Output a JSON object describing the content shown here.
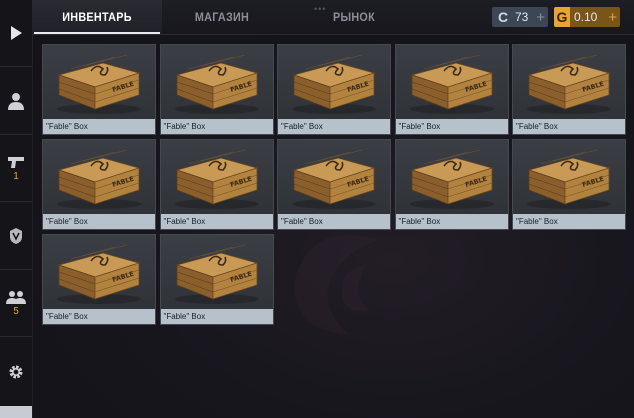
{
  "tabs": [
    {
      "label": "ИНВЕНТАРЬ",
      "active": true
    },
    {
      "label": "МАГАЗИН",
      "active": false
    },
    {
      "label": "РЫНОК",
      "active": false
    }
  ],
  "currency": {
    "silver": {
      "icon": "C",
      "value": "73",
      "plus": "+"
    },
    "gold": {
      "icon": "G",
      "value": "0.10",
      "plus": "+"
    }
  },
  "sidebar": {
    "items": [
      {
        "icon": "play-icon",
        "count": ""
      },
      {
        "icon": "profile-icon",
        "count": ""
      },
      {
        "icon": "pistol-icon",
        "count": "1"
      },
      {
        "icon": "emblem-icon",
        "count": ""
      },
      {
        "icon": "friends-icon",
        "count": "5"
      },
      {
        "icon": "gear-icon",
        "count": ""
      }
    ]
  },
  "inventory": {
    "items": [
      {
        "name": "\"Fable\" Box",
        "stamp": "FABLE"
      },
      {
        "name": "\"Fable\" Box",
        "stamp": "FABLE"
      },
      {
        "name": "\"Fable\" Box",
        "stamp": "FABLE"
      },
      {
        "name": "\"Fable\" Box",
        "stamp": "FABLE"
      },
      {
        "name": "\"Fable\" Box",
        "stamp": "FABLE"
      },
      {
        "name": "\"Fable\" Box",
        "stamp": "FABLE"
      },
      {
        "name": "\"Fable\" Box",
        "stamp": "FABLE"
      },
      {
        "name": "\"Fable\" Box",
        "stamp": "FABLE"
      },
      {
        "name": "\"Fable\" Box",
        "stamp": "FABLE"
      },
      {
        "name": "\"Fable\" Box",
        "stamp": "FABLE"
      },
      {
        "name": "\"Fable\" Box",
        "stamp": "FABLE"
      },
      {
        "name": "\"Fable\" Box",
        "stamp": "FABLE"
      }
    ]
  },
  "colors": {
    "accent": "#e8a532",
    "label_bg": "#b7c1cc",
    "wood_light": "#c89a55",
    "wood_dark": "#8a5f2c"
  }
}
